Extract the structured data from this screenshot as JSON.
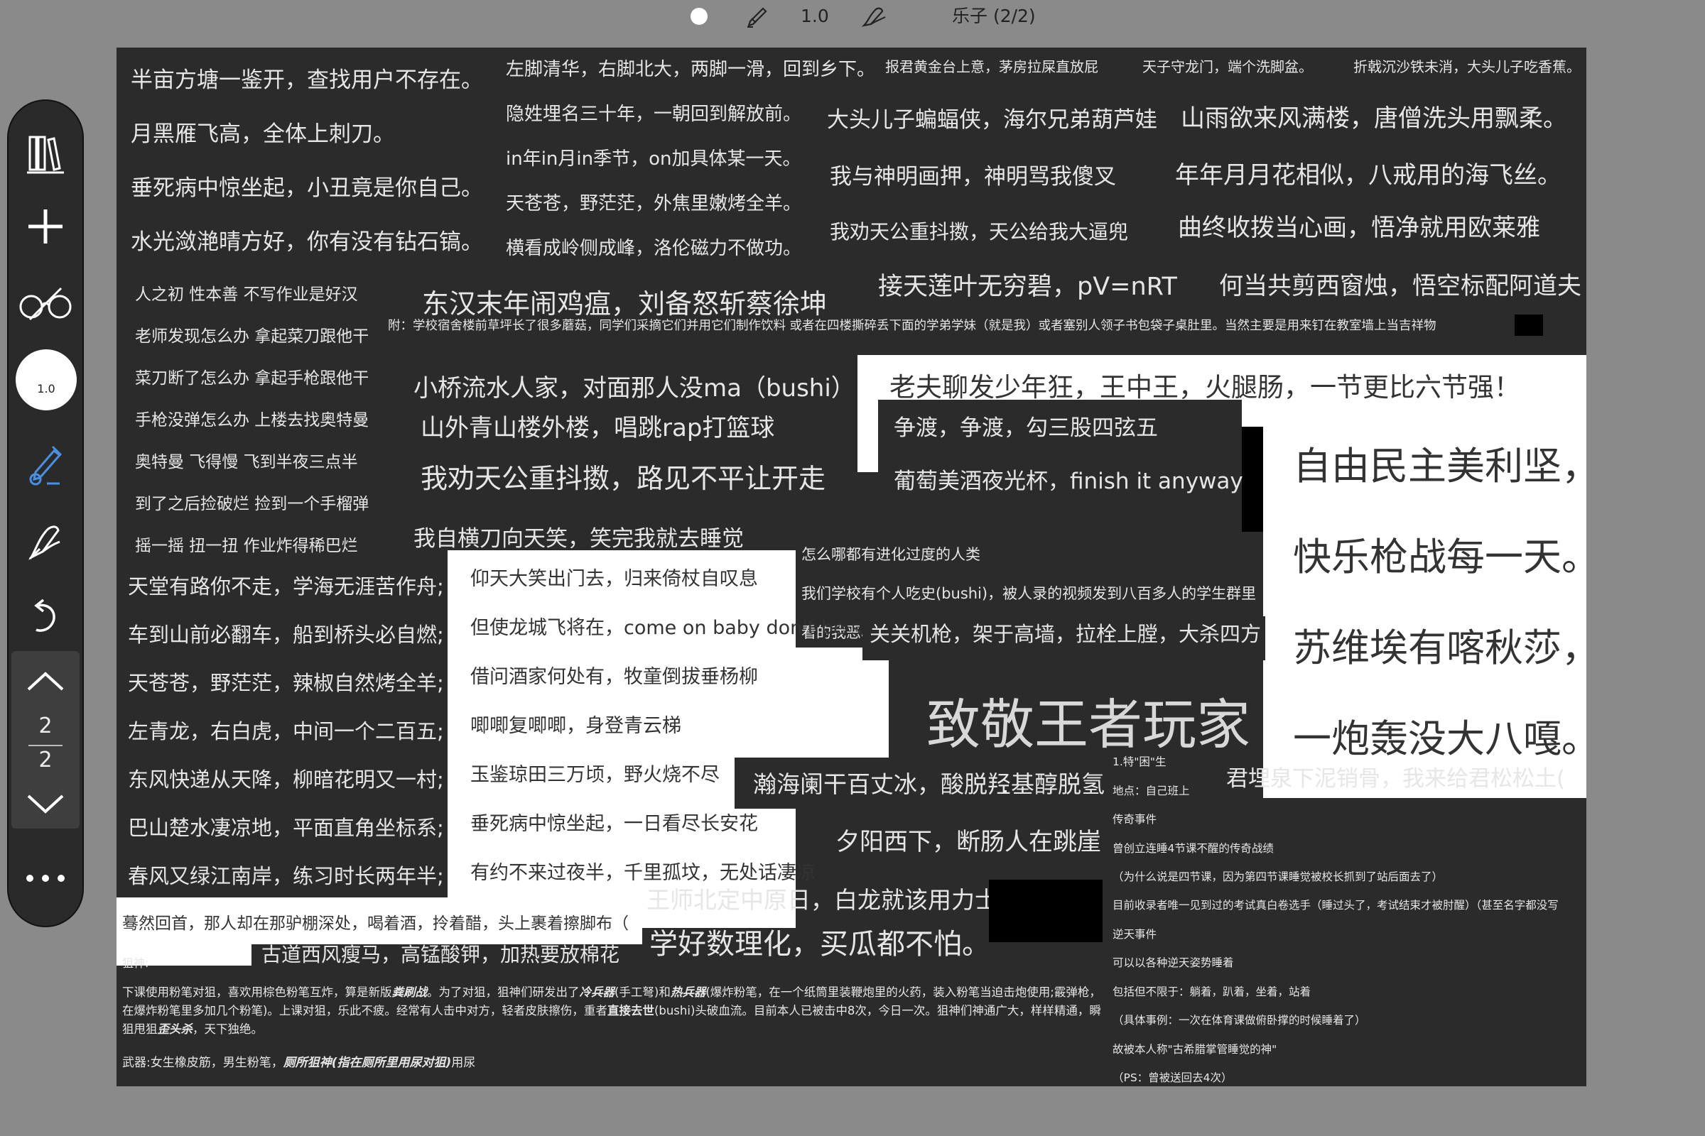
{
  "toolbar": {
    "size_value": "1.0",
    "doc_title": "乐子 (2/2)"
  },
  "sidebar": {
    "size_label": "1.0",
    "page_current": "2",
    "page_total": "2"
  },
  "canvas": {
    "left_col": [
      "半亩方塘一鉴开，查找用户不存在。",
      "月黑雁飞高，全体上刺刀。",
      "垂死病中惊坐起，小丑竟是你自己。",
      "水光潋滟晴方好，你有没有钻石镐。"
    ],
    "mid_col": [
      "左脚清华，右脚北大，两脚一滑，回到乡下。",
      "隐姓埋名三十年，一朝回到解放前。",
      "in年in月in季节，on加具体某一天。",
      "天苍苍，野茫茫，外焦里嫩烤全羊。",
      "横看成岭侧成峰，洛伦磁力不做功。"
    ],
    "top_small": [
      "报君黄金台上意，茅房拉屎直放屁",
      "天子守龙门，端个洗脚盆。",
      "折戟沉沙铁未消，大头儿子吃香蕉。"
    ],
    "right_lines": [
      "大头儿子蝙蝠侠，海尔兄弟葫芦娃",
      "山雨欲来风满楼，唐僧洗头用飘柔。",
      "我与神明画押，神明骂我傻叉",
      "年年月月花相似，八戒用的海飞丝。",
      "我劝天公重抖擞，天公给我大逼兜",
      "曲终收拨当心画，悟净就用欧莱雅",
      "接天莲叶无穷碧，pV=nRT",
      "何当共剪西窗烛，悟空标配阿道夫"
    ],
    "chain": [
      "人之初 性本善 不写作业是好汉",
      "老师发现怎么办 拿起菜刀跟他干",
      "菜刀断了怎么办 拿起手枪跟他干",
      "手枪没弹怎么办 上楼去找奥特曼",
      "奥特曼 飞得慢 飞到半夜三点半",
      "到了之后捡破烂 捡到一个手榴弹",
      "摇一摇 扭一扭 作业炸得稀巴烂"
    ],
    "east_han": "东汉末年闹鸡瘟，刘备怒斩蔡徐坤",
    "appendix": "附：学校宿舍楼前草坪长了很多蘑菇，同学们采摘它们并用它们制作饮料 或者在四楼撕碎丢下面的学弟学妹（就是我）或者塞别人领子书包袋子桌肚里。当然主要是用来钉在教室墙上当吉祥物",
    "mid_block": [
      "小桥流水人家，对面那人没ma（bushi）",
      "山外青山楼外楼，唱跳rap打篮球",
      "我劝天公重抖擞，路见不平让开走",
      "我自横刀向天笑，笑完我就去睡觉"
    ],
    "old_man": "老夫聊发少年狂，王中王，火腿肠，一节更比六节强！",
    "zhengdu": "争渡，争渡，勾三股四弦五",
    "putao": "葡萄美酒夜光杯，finish it anyway",
    "evolve": [
      "怎么哪都有进化过度的人类",
      "我们学校有个人吃史(bushi)，被人录的视频发到八百多人的学生群里",
      "看的我恶心"
    ],
    "freedom": [
      "自由民主美利坚，",
      "快乐枪战每一天。",
      "苏维埃有喀秋莎，",
      "一炮轰没大八嘎。"
    ],
    "left_lower": [
      "天堂有路你不走，学海无涯苦作舟;",
      "车到山前必翻车，船到桥头必自燃;",
      "天苍苍，野茫茫，辣椒自然烤全羊;",
      "左青龙，右白虎，中间一个二百五;",
      "东风快递从天降，柳暗花明又一村;",
      "巴山楚水凄凉地，平面直角坐标系;",
      "春风又绿江南岸，练习时长两年半;"
    ],
    "white_block": [
      "仰天大笑出门去，归来倚杖自叹息",
      "但使龙城飞将在，come on baby don't be shy",
      "借问酒家何处有，牧童倒拔垂杨柳",
      "唧唧复唧唧，身登青云梯",
      "玉鉴琼田三万顷，野火烧不尽",
      "垂死病中惊坐起，一日看尽长安花",
      "有约不来过夜半，千里孤坟，无处话凄凉"
    ],
    "guanguan": "关关机枪，架于高墙，拉栓上膛，大杀四方",
    "king": "致敬王者玩家",
    "hanhai": "瀚海阑干百丈冰，酸脱羟基醇脱氢",
    "xiyang": "夕阳西下，断肠人在跳崖",
    "wangshi": "王师北定中原日，白龙就该用力士",
    "shuli": "学好数理化，买瓜都不怕。",
    "mohran": "蓦然回首，那人却在那驴棚深处，喝着酒，拎着醋，头上裹着擦脚布（",
    "gudao": "古道西风瘦马，高锰酸钾，加热要放棉花",
    "junmai": "君埋泉下泥销骨，我来给君松松土(",
    "sniper": {
      "title": "狙神:",
      "body1": "下课使用粉笔对狙，喜欢用棕色粉笔互炸，算是新版",
      "b1": "粪刷战",
      "body2": "。为了对狙，狙神们研发出了",
      "b2": "冷兵器",
      "body3": "(手工弩)和",
      "b3": "热兵器",
      "body4": "(爆炸粉笔，在一个纸筒里装鞭炮里的火药，装入粉笔当迫击炮使用;霰弹枪，在爆炸粉笔里多加几个粉笔)。上课对狙，乐此不疲。经常有人击中对方，轻者皮肤擦伤，重者",
      "b4": "直接去世",
      "body5": "(bushi)头破血流。目前本人已被击中8次，今日一次。狙神们神通广大，样样精通，瞬狙甩狙",
      "b5": "歪头杀",
      "body6": "，天下独绝。",
      "weapon1": "武器:女生橡皮筋，男生粉笔，",
      "weapon2": "厕所狙神(指在厕所里用尿对狙)",
      "weapon3": "用尿"
    },
    "legend": [
      "1.特\"困\"生",
      "地点：自己班上",
      "传奇事件",
      "曾创立连睡4节课不醒的传奇战绩",
      "（为什么说是四节课，因为第四节课睡觉被校长抓到了站后面去了）",
      "目前收录者唯一见到过的考试真白卷选手（睡过头了，考试结束才被肘醒）（甚至名字都没写",
      "逆天事件",
      "可以以各种逆天姿势睡着",
      "包括但不限于：躺着，趴着，坐着，站着",
      "（具体事例：一次在体育课做俯卧撑的时候睡着了）",
      "故被本人称\"古希腊掌管睡觉的神\"",
      "（PS：曾被送回去4次）"
    ]
  }
}
